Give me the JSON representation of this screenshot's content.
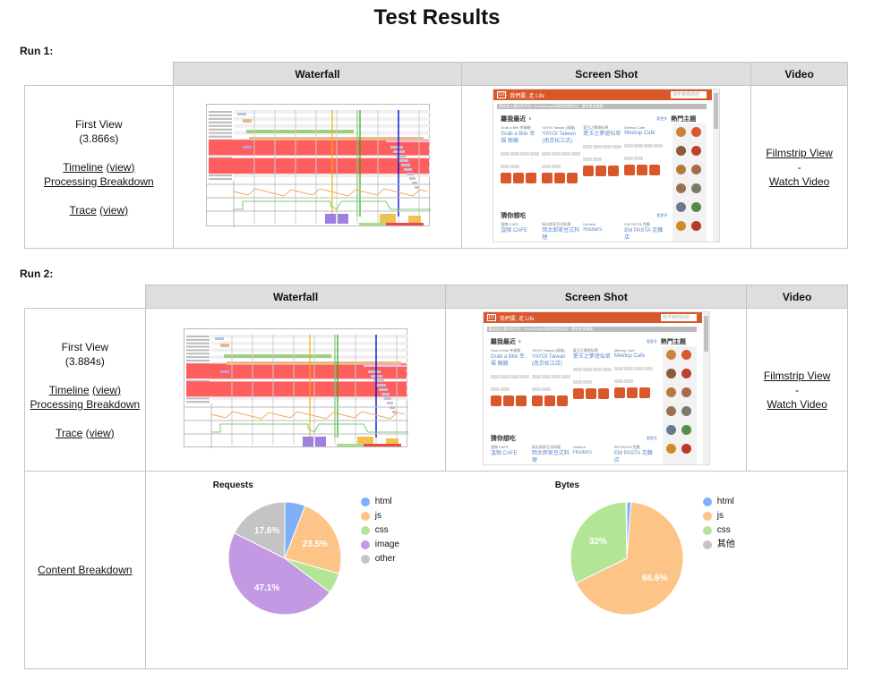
{
  "page_title": "Test Results",
  "columns": {
    "waterfall": "Waterfall",
    "screenshot": "Screen Shot",
    "video": "Video"
  },
  "runs": [
    {
      "label": "Run 1:",
      "view_name": "First View",
      "load_time": "(3.866s)",
      "timeline_label": "Timeline",
      "timeline_view": "(view)",
      "processing_label": "Processing Breakdown",
      "trace_label": "Trace",
      "trace_view": "(view)",
      "filmstrip_label": "Filmstrip View",
      "separator": "-",
      "watch_label": "Watch Video"
    },
    {
      "label": "Run 2:",
      "view_name": "First View",
      "load_time": "(3.884s)",
      "timeline_label": "Timeline",
      "timeline_view": "(view)",
      "processing_label": "Processing Breakdown",
      "trace_label": "Trace",
      "trace_view": "(view)",
      "filmstrip_label": "Filmstrip View",
      "separator": "-",
      "watch_label": "Watch Video"
    }
  ],
  "screenshot": {
    "brand": "我們要, 走 Life",
    "search_placeholder": "找不到你的店",
    "notice": "歡迎加入最好的平台 · Kowabunga的幫你找到好店 · 還有更多優惠",
    "section1_title": "離我最近 ♀",
    "section2_title": "猜你想吃",
    "more": "看更多",
    "themes_title": "熱門主題",
    "nearby": [
      {
        "caption": "Grab a Bite 幸福餐",
        "name": "Grab a Bite 幸福 眼鏡"
      },
      {
        "caption": "YAYOI Taiwan (高雄)",
        "name": "YAYOI Taiwan (南京松江店)"
      },
      {
        "caption": "愛玉之夢遊仙草",
        "name": "愛玉之夢遊仙草"
      },
      {
        "caption": "Meetup Cafe",
        "name": "Meetup Cafe"
      }
    ],
    "suggest": [
      {
        "caption": "溫咖 CAFE",
        "name": "溫咖 CAFE"
      },
      {
        "caption": "岡太郎家豆式料理",
        "name": "岡太郎家豆式料理"
      },
      {
        "caption": "Hooters",
        "name": "Hooters"
      },
      {
        "caption": "EM PASTA 克麵",
        "name": "EM PASTA 克麵 店"
      }
    ]
  },
  "content_breakdown": {
    "label": "Content Breakdown"
  },
  "chart_data": [
    {
      "type": "pie",
      "title": "Requests",
      "categories": [
        "html",
        "js",
        "css",
        "image",
        "other"
      ],
      "values": [
        5.9,
        23.5,
        5.9,
        47.1,
        17.6
      ],
      "labels": [
        "",
        "23.5%",
        "",
        "47.1%",
        "17.6%"
      ],
      "colors": [
        "#7fb0f7",
        "#fdc487",
        "#b3e597",
        "#c499e4",
        "#c4c4c4"
      ],
      "legend": "right"
    },
    {
      "type": "pie",
      "title": "Bytes",
      "categories": [
        "html",
        "js",
        "css",
        "其他"
      ],
      "values": [
        1.2,
        66.6,
        32.0,
        0.2
      ],
      "labels": [
        "",
        "66.6%",
        "32%",
        ""
      ],
      "colors": [
        "#7fb0f7",
        "#fdc487",
        "#b3e597",
        "#c4c4c4"
      ],
      "legend": "right"
    }
  ]
}
